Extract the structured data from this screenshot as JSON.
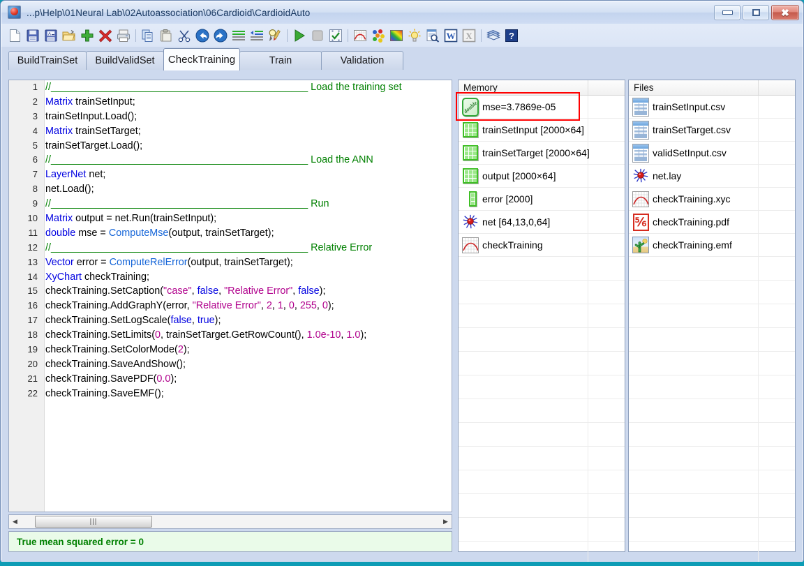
{
  "window": {
    "title": "...p\\Help\\01Neural Lab\\02Autoassociation\\06Cardioid\\CardioidAuto",
    "app_icon": "red-ball-icon",
    "buttons": {
      "minimize": "minimize-icon",
      "maximize": "maximize-icon",
      "close": "close-icon"
    }
  },
  "toolbar": {
    "items": [
      {
        "name": "new-file-icon"
      },
      {
        "name": "save-icon"
      },
      {
        "name": "save-as-icon"
      },
      {
        "name": "open-folder-icon"
      },
      {
        "name": "add-icon"
      },
      {
        "name": "delete-icon"
      },
      {
        "name": "print-icon"
      },
      {
        "name": "separator"
      },
      {
        "name": "copy-icon"
      },
      {
        "name": "paste-icon"
      },
      {
        "name": "cut-icon"
      },
      {
        "name": "undo-icon"
      },
      {
        "name": "redo-icon"
      },
      {
        "name": "indent-lines-icon"
      },
      {
        "name": "outdent-lines-icon"
      },
      {
        "name": "find-replace-icon"
      },
      {
        "name": "separator"
      },
      {
        "name": "run-icon"
      },
      {
        "name": "stop-icon"
      },
      {
        "name": "check-icon"
      },
      {
        "name": "separator"
      },
      {
        "name": "xychart-icon"
      },
      {
        "name": "scatter-colors-icon"
      },
      {
        "name": "rainbow-image-icon"
      },
      {
        "name": "lightbulb-icon"
      },
      {
        "name": "preview-icon"
      },
      {
        "name": "word-export-icon"
      },
      {
        "name": "excel-export-icon"
      },
      {
        "name": "separator"
      },
      {
        "name": "help-book-icon"
      },
      {
        "name": "help-question-icon"
      }
    ]
  },
  "tabs": {
    "active_index": 2,
    "items": [
      {
        "label": "BuildTrainSet"
      },
      {
        "label": "BuildValidSet"
      },
      {
        "label": "CheckTraining"
      },
      {
        "label": "Train"
      },
      {
        "label": "Validation"
      }
    ]
  },
  "editor": {
    "line_numbers": [
      "1",
      "2",
      "3",
      "4",
      "5",
      "6",
      "7",
      "8",
      "9",
      "10",
      "11",
      "12",
      "13",
      "14",
      "15",
      "16",
      "17",
      "18",
      "19",
      "20",
      "21",
      "22"
    ],
    "lines": [
      {
        "n": 1,
        "segments": [
          {
            "t": "//______________________________________________ ",
            "c": "cm"
          },
          {
            "t": "Load the training set",
            "c": "cm"
          }
        ]
      },
      {
        "n": 2,
        "segments": [
          {
            "t": "Matrix",
            "c": "kw"
          },
          {
            "t": " trainSetInput;",
            "c": ""
          }
        ]
      },
      {
        "n": 3,
        "segments": [
          {
            "t": "trainSetInput.Load();",
            "c": ""
          }
        ]
      },
      {
        "n": 4,
        "segments": [
          {
            "t": "Matrix",
            "c": "kw"
          },
          {
            "t": " trainSetTarget;",
            "c": ""
          }
        ]
      },
      {
        "n": 5,
        "segments": [
          {
            "t": "trainSetTarget.Load();",
            "c": ""
          }
        ]
      },
      {
        "n": 6,
        "segments": [
          {
            "t": "//______________________________________________ ",
            "c": "cm"
          },
          {
            "t": "Load the ANN",
            "c": "cm"
          }
        ]
      },
      {
        "n": 7,
        "segments": [
          {
            "t": "LayerNet",
            "c": "kw"
          },
          {
            "t": " net;",
            "c": ""
          }
        ]
      },
      {
        "n": 8,
        "segments": [
          {
            "t": "net.Load();",
            "c": ""
          }
        ]
      },
      {
        "n": 9,
        "segments": [
          {
            "t": "//______________________________________________ ",
            "c": "cm"
          },
          {
            "t": "Run",
            "c": "cm"
          }
        ]
      },
      {
        "n": 10,
        "segments": [
          {
            "t": "Matrix",
            "c": "kw"
          },
          {
            "t": " output = net.Run(trainSetInput);",
            "c": ""
          }
        ]
      },
      {
        "n": 11,
        "segments": [
          {
            "t": "double",
            "c": "kw"
          },
          {
            "t": " mse = ",
            "c": ""
          },
          {
            "t": "ComputeMse",
            "c": "fn"
          },
          {
            "t": "(output, trainSetTarget);",
            "c": ""
          }
        ]
      },
      {
        "n": 12,
        "segments": [
          {
            "t": "//______________________________________________ ",
            "c": "cm"
          },
          {
            "t": "Relative Error",
            "c": "cm"
          }
        ]
      },
      {
        "n": 13,
        "segments": [
          {
            "t": "Vector",
            "c": "kw"
          },
          {
            "t": " error = ",
            "c": ""
          },
          {
            "t": "ComputeRelError",
            "c": "fn"
          },
          {
            "t": "(output, trainSetTarget);",
            "c": ""
          }
        ]
      },
      {
        "n": 14,
        "segments": [
          {
            "t": "XyChart",
            "c": "kw"
          },
          {
            "t": " checkTraining;",
            "c": ""
          }
        ]
      },
      {
        "n": 15,
        "segments": [
          {
            "t": "checkTraining.SetCaption(",
            "c": ""
          },
          {
            "t": "\"case\"",
            "c": "str"
          },
          {
            "t": ", ",
            "c": ""
          },
          {
            "t": "false",
            "c": "kw"
          },
          {
            "t": ", ",
            "c": ""
          },
          {
            "t": "\"Relative Error\"",
            "c": "str"
          },
          {
            "t": ", ",
            "c": ""
          },
          {
            "t": "false",
            "c": "kw"
          },
          {
            "t": ");",
            "c": ""
          }
        ]
      },
      {
        "n": 16,
        "segments": [
          {
            "t": "checkTraining.AddGraphY(error, ",
            "c": ""
          },
          {
            "t": "\"Relative Error\"",
            "c": "str"
          },
          {
            "t": ", ",
            "c": ""
          },
          {
            "t": "2",
            "c": "num"
          },
          {
            "t": ", ",
            "c": ""
          },
          {
            "t": "1",
            "c": "num"
          },
          {
            "t": ", ",
            "c": ""
          },
          {
            "t": "0",
            "c": "num"
          },
          {
            "t": ", ",
            "c": ""
          },
          {
            "t": "255",
            "c": "num"
          },
          {
            "t": ", ",
            "c": ""
          },
          {
            "t": "0",
            "c": "num"
          },
          {
            "t": ");",
            "c": ""
          }
        ]
      },
      {
        "n": 17,
        "segments": [
          {
            "t": "checkTraining.SetLogScale(",
            "c": ""
          },
          {
            "t": "false",
            "c": "kw"
          },
          {
            "t": ", ",
            "c": ""
          },
          {
            "t": "true",
            "c": "kw"
          },
          {
            "t": ");",
            "c": ""
          }
        ]
      },
      {
        "n": 18,
        "segments": [
          {
            "t": "checkTraining.SetLimits(",
            "c": ""
          },
          {
            "t": "0",
            "c": "num"
          },
          {
            "t": ", trainSetTarget.GetRowCount(), ",
            "c": ""
          },
          {
            "t": "1.0e-10",
            "c": "num"
          },
          {
            "t": ", ",
            "c": ""
          },
          {
            "t": "1.0",
            "c": "num"
          },
          {
            "t": ");",
            "c": ""
          }
        ]
      },
      {
        "n": 19,
        "segments": [
          {
            "t": "checkTraining.SetColorMode(",
            "c": ""
          },
          {
            "t": "2",
            "c": "num"
          },
          {
            "t": ");",
            "c": ""
          }
        ]
      },
      {
        "n": 20,
        "segments": [
          {
            "t": "checkTraining.SaveAndShow();",
            "c": ""
          }
        ]
      },
      {
        "n": 21,
        "segments": [
          {
            "t": "checkTraining.SavePDF(",
            "c": ""
          },
          {
            "t": "0.0",
            "c": "num"
          },
          {
            "t": ");",
            "c": ""
          }
        ]
      },
      {
        "n": 22,
        "segments": [
          {
            "t": "checkTraining.SaveEMF();",
            "c": ""
          }
        ]
      }
    ]
  },
  "hscrollbar": {
    "left_arrow": "◀",
    "right_arrow": "▶",
    "thumb_grip": "|||"
  },
  "statusbar": {
    "text": "True mean squared error = 0",
    "color": "#008000",
    "background": "#eafbe9"
  },
  "memory_panel": {
    "header": "Memory",
    "rows": [
      {
        "icon": "double-scalar-icon",
        "label": "mse=3.7869e-05",
        "highlighted": true
      },
      {
        "icon": "matrix-icon",
        "label": "trainSetInput [2000×64]"
      },
      {
        "icon": "matrix-icon",
        "label": "trainSetTarget [2000×64]"
      },
      {
        "icon": "matrix-icon",
        "label": "output [2000×64]"
      },
      {
        "icon": "vector-icon",
        "label": "error [2000]"
      },
      {
        "icon": "neural-net-icon",
        "label": "net [64,13,0,64]"
      },
      {
        "icon": "xychart-icon",
        "label": "checkTraining"
      }
    ]
  },
  "files_panel": {
    "header": "Files",
    "rows": [
      {
        "icon": "csv-file-icon",
        "label": "trainSetInput.csv"
      },
      {
        "icon": "csv-file-icon",
        "label": "trainSetTarget.csv"
      },
      {
        "icon": "csv-file-icon",
        "label": "validSetInput.csv"
      },
      {
        "icon": "neural-net-icon",
        "label": "net.lay"
      },
      {
        "icon": "xychart-file-icon",
        "label": "checkTraining.xyc"
      },
      {
        "icon": "pdf-file-icon",
        "label": "checkTraining.pdf"
      },
      {
        "icon": "emf-image-icon",
        "label": "checkTraining.emf"
      }
    ]
  },
  "annotation": {
    "highlight_color": "#ff0000",
    "target": "mse=3.7869e-05"
  }
}
